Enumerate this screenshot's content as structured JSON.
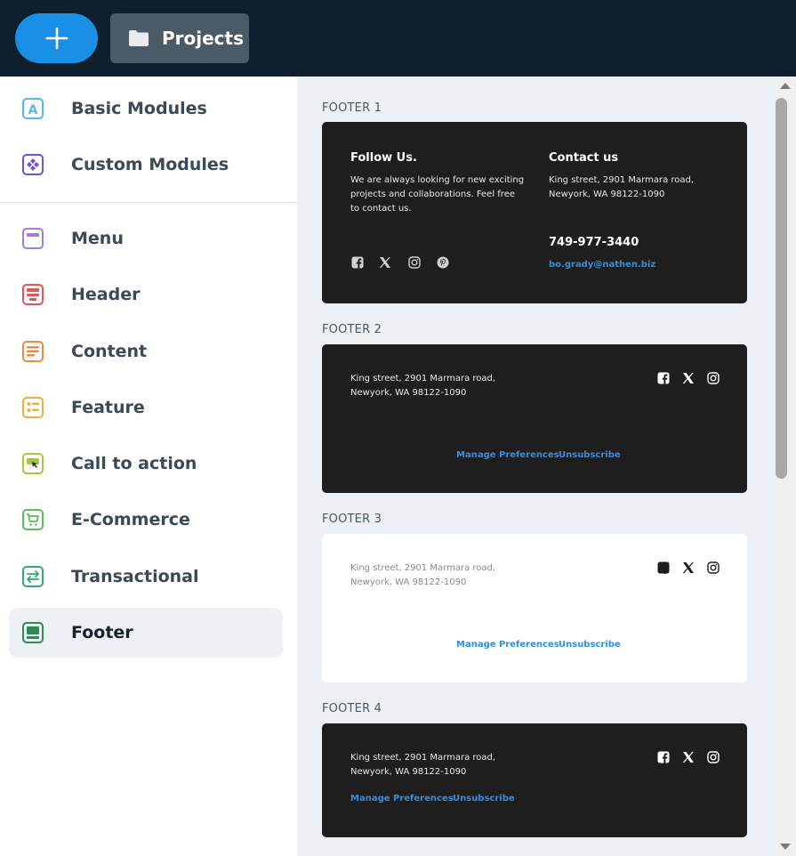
{
  "toolbar": {
    "add_icon": "plus-icon",
    "projects_label": "Projects",
    "projects_icon": "folder-icon"
  },
  "sidebar": {
    "items": [
      {
        "label": "Basic Modules",
        "icon": "basic-modules-icon",
        "color": "#5ab8e8"
      },
      {
        "label": "Custom Modules",
        "icon": "custom-modules-icon",
        "color": "#7a4fd0"
      },
      {
        "label": "Menu",
        "icon": "menu-icon",
        "color": "#a97ad8"
      },
      {
        "label": "Header",
        "icon": "header-icon",
        "color": "#e05656"
      },
      {
        "label": "Content",
        "icon": "content-icon",
        "color": "#ef8a42"
      },
      {
        "label": "Feature",
        "icon": "feature-icon",
        "color": "#eab23a"
      },
      {
        "label": "Call to action",
        "icon": "call-to-action-icon",
        "color": "#a8c83a"
      },
      {
        "label": "E-Commerce",
        "icon": "e-commerce-icon",
        "color": "#5dbb5e"
      },
      {
        "label": "Transactional",
        "icon": "transactional-icon",
        "color": "#33a96a"
      },
      {
        "label": "Footer",
        "icon": "footer-icon",
        "color": "#2e8a58"
      }
    ],
    "active": "Footer"
  },
  "footers": {
    "f1": {
      "title": "FOOTER 1",
      "follow_heading": "Follow Us.",
      "follow_text_1": "We are always looking for new exciting",
      "follow_text_2": "projects and collaborations. Feel free",
      "follow_text_3": "to contact us.",
      "contact_heading": "Contact us",
      "address_1": "King street, 2901 Marmara road,",
      "address_2": "Newyork, WA 98122-1090",
      "phone": "749-977-3440",
      "email": "bo.grady@nathen.biz"
    },
    "f2": {
      "title": "FOOTER 2",
      "address_1": "King street, 2901 Marmara road,",
      "address_2": "Newyork, WA 98122-1090",
      "manage": "Manage Preferences",
      "unsubscribe": "Unsubscribe"
    },
    "f3": {
      "title": "FOOTER 3",
      "address_1": "King street, 2901 Marmara road,",
      "address_2": "Newyork, WA 98122-1090",
      "manage": "Manage Preferences",
      "unsubscribe": "Unsubscribe"
    },
    "f4": {
      "title": "FOOTER 4",
      "address_1": "King street, 2901 Marmara road,",
      "address_2": "Newyork, WA 98122-1090",
      "manage": "Manage Preferences",
      "unsubscribe": "Unsubscribe"
    }
  },
  "social_icons": [
    "facebook-icon",
    "x-icon",
    "instagram-icon",
    "pinterest-icon"
  ],
  "colors": {
    "topbar": "#0f1f2e",
    "accent": "#1a8fe6",
    "link": "#2f8fe3",
    "card_dark": "#1e1e1e"
  }
}
